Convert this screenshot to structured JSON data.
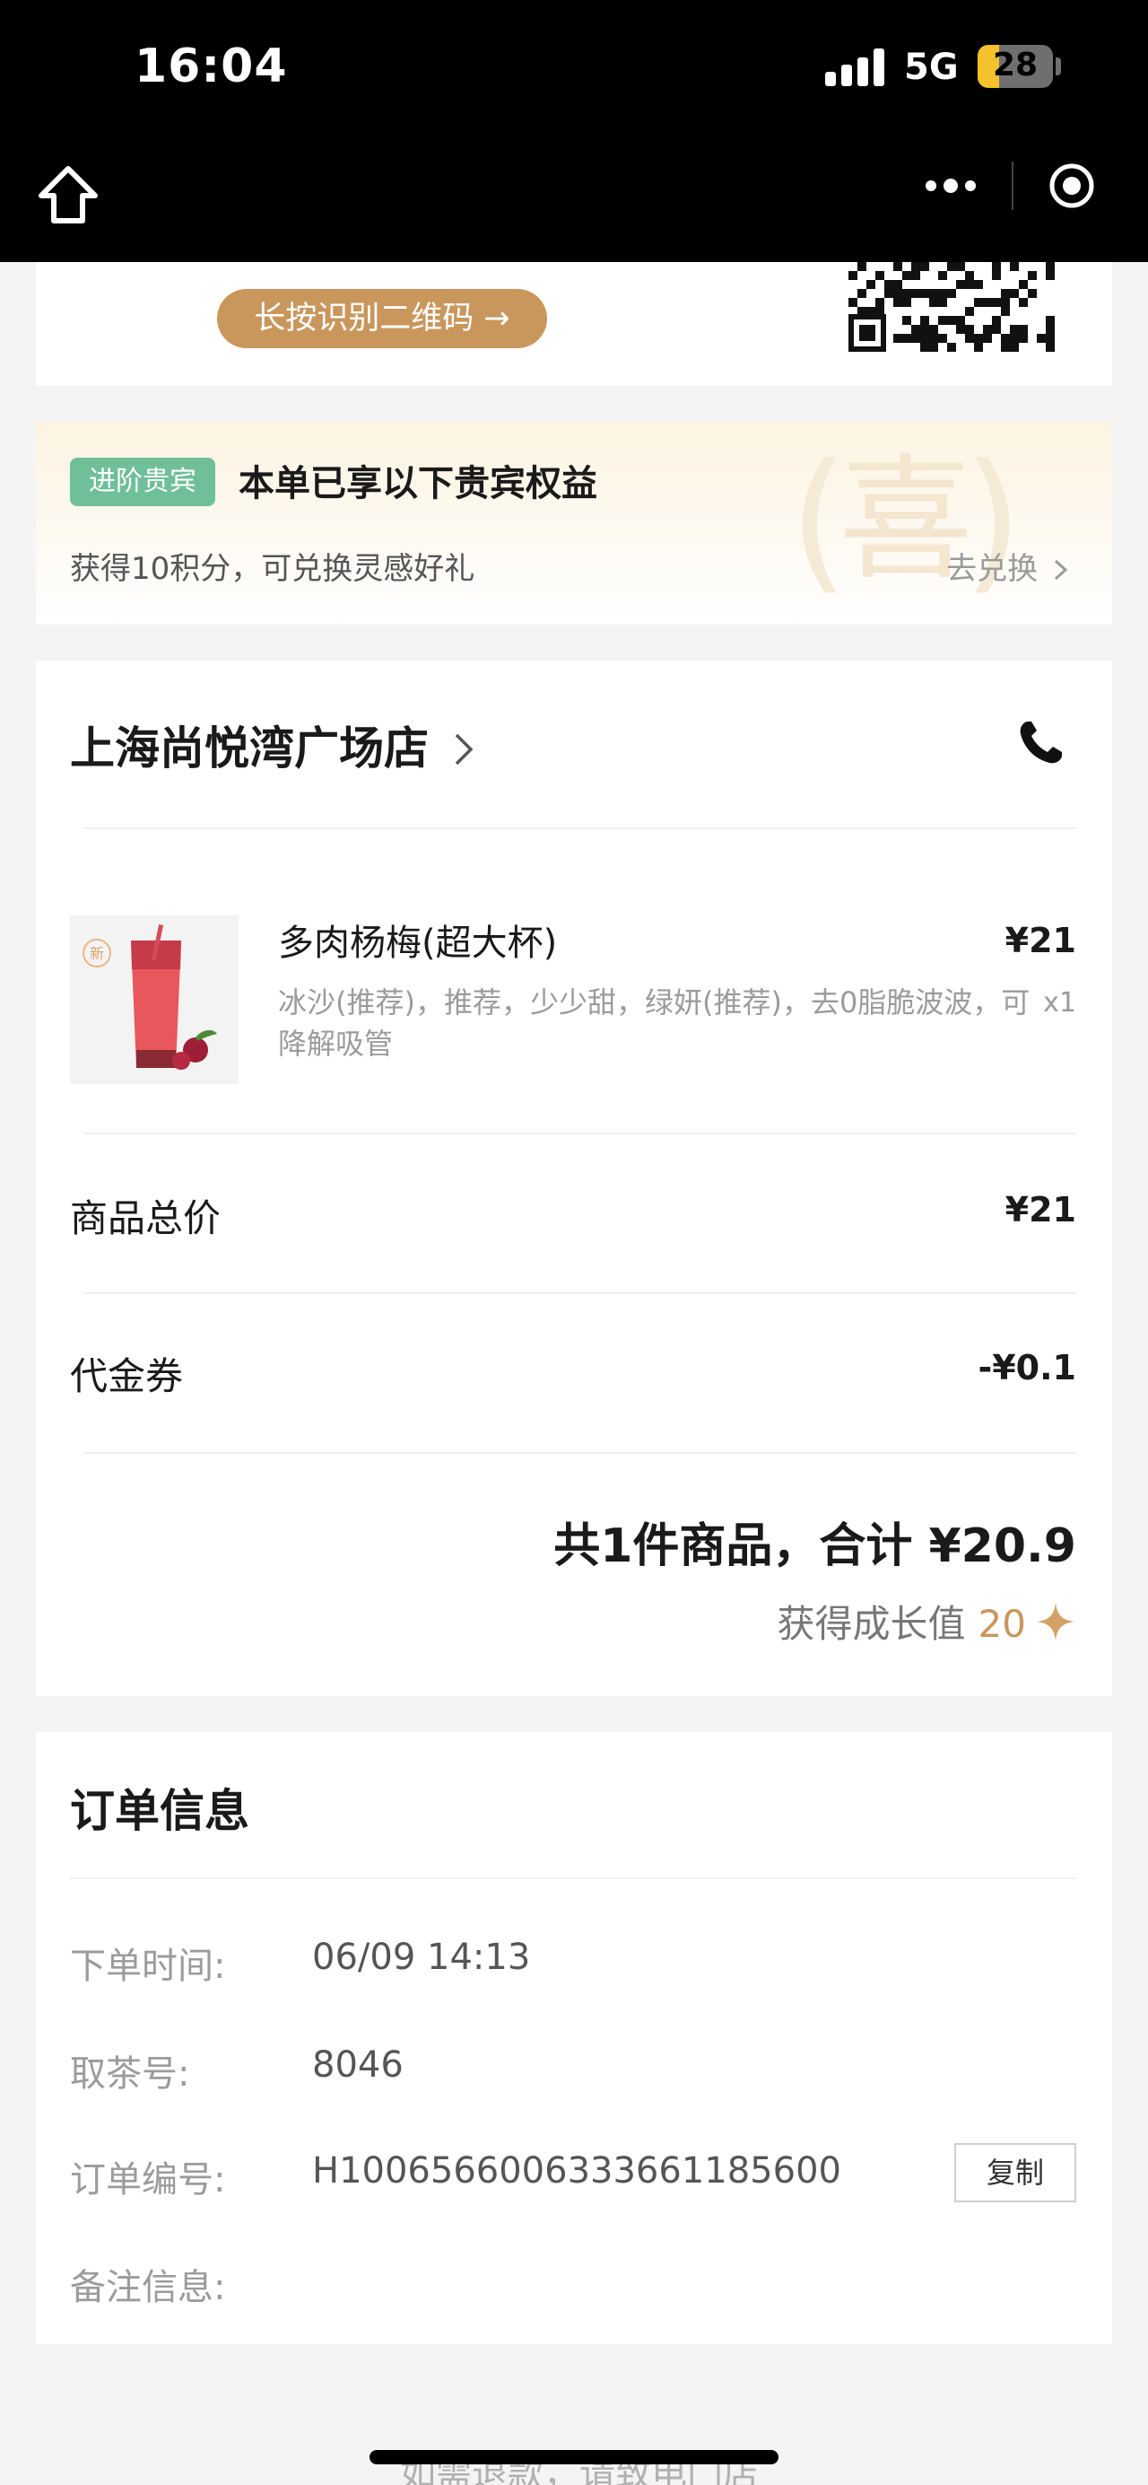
{
  "status_bar": {
    "time": "16:04",
    "network": "5G",
    "battery": "28",
    "battery_level": 0.28
  },
  "nav": {
    "home_icon": "home-icon",
    "more_icon": "more-icon",
    "close_icon": "close-circle-icon"
  },
  "qr_section": {
    "button_label": "长按识别二维码 →"
  },
  "vip": {
    "badge": "进阶贵宾",
    "title": "本单已享以下贵宾权益",
    "subtitle": "获得10积分，可兑换灵感好礼",
    "link": "去兑换",
    "watermark": "喜"
  },
  "order": {
    "store_name": "上海尚悦湾广场店",
    "product": {
      "tag": "新",
      "name": "多肉杨梅(超大杯)",
      "options": "冰沙(推荐)，推荐，少少甜，绿妍(推荐)，去0脂脆波波，可降解吸管",
      "price": "¥21",
      "qty": "x1"
    },
    "subtotal_label": "商品总价",
    "subtotal_value": "¥21",
    "voucher_label": "代金券",
    "voucher_value": "-¥0.1",
    "total_text": "共1件商品，合计 ¥20.9",
    "growth_label": "获得成长值",
    "growth_value": "20"
  },
  "info": {
    "title": "订单信息",
    "time_label": "下单时间:",
    "time_value": "06/09 14:13",
    "pickup_label": "取茶号:",
    "pickup_value": "8046",
    "order_no_label": "订单编号:",
    "order_no_value": "H1006566006333661185600",
    "copy_button": "复制",
    "note_label": "备注信息:",
    "note_value": ""
  },
  "footer": {
    "text": "如需退款，请致电门店"
  },
  "colors": {
    "accent_gold": "#c9965c",
    "badge_green": "#6fbf98",
    "bar_black": "#000000"
  }
}
